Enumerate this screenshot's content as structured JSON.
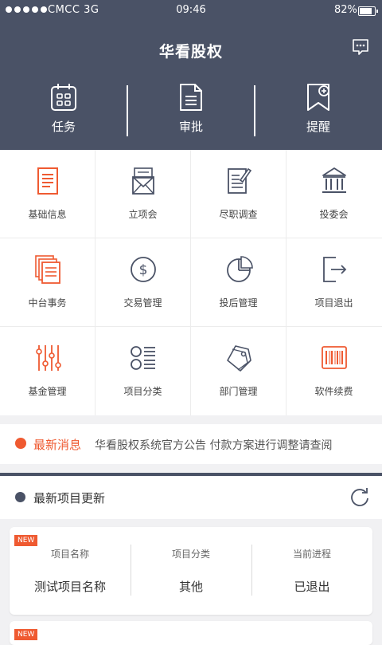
{
  "status_bar": {
    "carrier": "CMCC  3G",
    "time": "09:46",
    "battery": "82%"
  },
  "header": {
    "title": "华看股权"
  },
  "quick_actions": [
    {
      "label": "任务",
      "icon": "calendar-icon"
    },
    {
      "label": "审批",
      "icon": "document-icon"
    },
    {
      "label": "提醒",
      "icon": "bookmark-plus-icon"
    }
  ],
  "menu": [
    {
      "label": "基础信息",
      "icon": "document-lines-icon"
    },
    {
      "label": "立项会",
      "icon": "envelope-icon"
    },
    {
      "label": "尽职调查",
      "icon": "document-pen-icon"
    },
    {
      "label": "投委会",
      "icon": "bank-icon"
    },
    {
      "label": "中台事务",
      "icon": "stacked-documents-icon"
    },
    {
      "label": "交易管理",
      "icon": "dollar-coin-icon"
    },
    {
      "label": "投后管理",
      "icon": "pie-chart-icon"
    },
    {
      "label": "项目退出",
      "icon": "exit-icon"
    },
    {
      "label": "基金管理",
      "icon": "sliders-icon"
    },
    {
      "label": "项目分类",
      "icon": "list-icon"
    },
    {
      "label": "部门管理",
      "icon": "tags-icon"
    },
    {
      "label": "软件续费",
      "icon": "barcode-icon"
    }
  ],
  "news": {
    "title": "最新消息",
    "text": "华看股权系统官方公告 付款方案进行调整请查阅"
  },
  "projects": {
    "title": "最新项目更新",
    "headers": [
      "项目名称",
      "项目分类",
      "当前进程"
    ],
    "badge": "NEW",
    "items": [
      {
        "name": "测试项目名称",
        "category": "其他",
        "progress": "已退出"
      }
    ]
  },
  "colors": {
    "header": "#4a5266",
    "accent": "#ef5a31"
  }
}
